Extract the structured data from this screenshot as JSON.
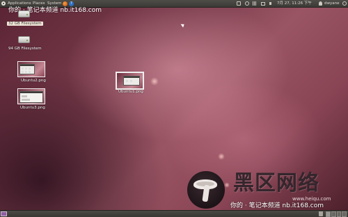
{
  "top_panel": {
    "menus": [
      "Applications",
      "Places",
      "System"
    ],
    "clock": "7月 27, 11:26 下午",
    "user": "dwyane"
  },
  "caption": "你的 · 笔记本频道 nb.it168.com",
  "desktop_icons": [
    {
      "label": "32 GB Filesystem",
      "type": "drive",
      "selected": true
    },
    {
      "label": "94 GB Filesystem",
      "type": "drive",
      "selected": false
    },
    {
      "label": "Ubuntu2.png",
      "type": "image"
    },
    {
      "label": "Ubuntu3.png",
      "type": "image"
    },
    {
      "label": "Ubuntu1.png",
      "type": "image"
    }
  ],
  "watermark": {
    "brand": "黑区网络",
    "url": "www.heiqu.com"
  },
  "colors": {
    "panel": "#3b3a36",
    "desktop": "#7a3c4c",
    "accent": "#e95420"
  }
}
